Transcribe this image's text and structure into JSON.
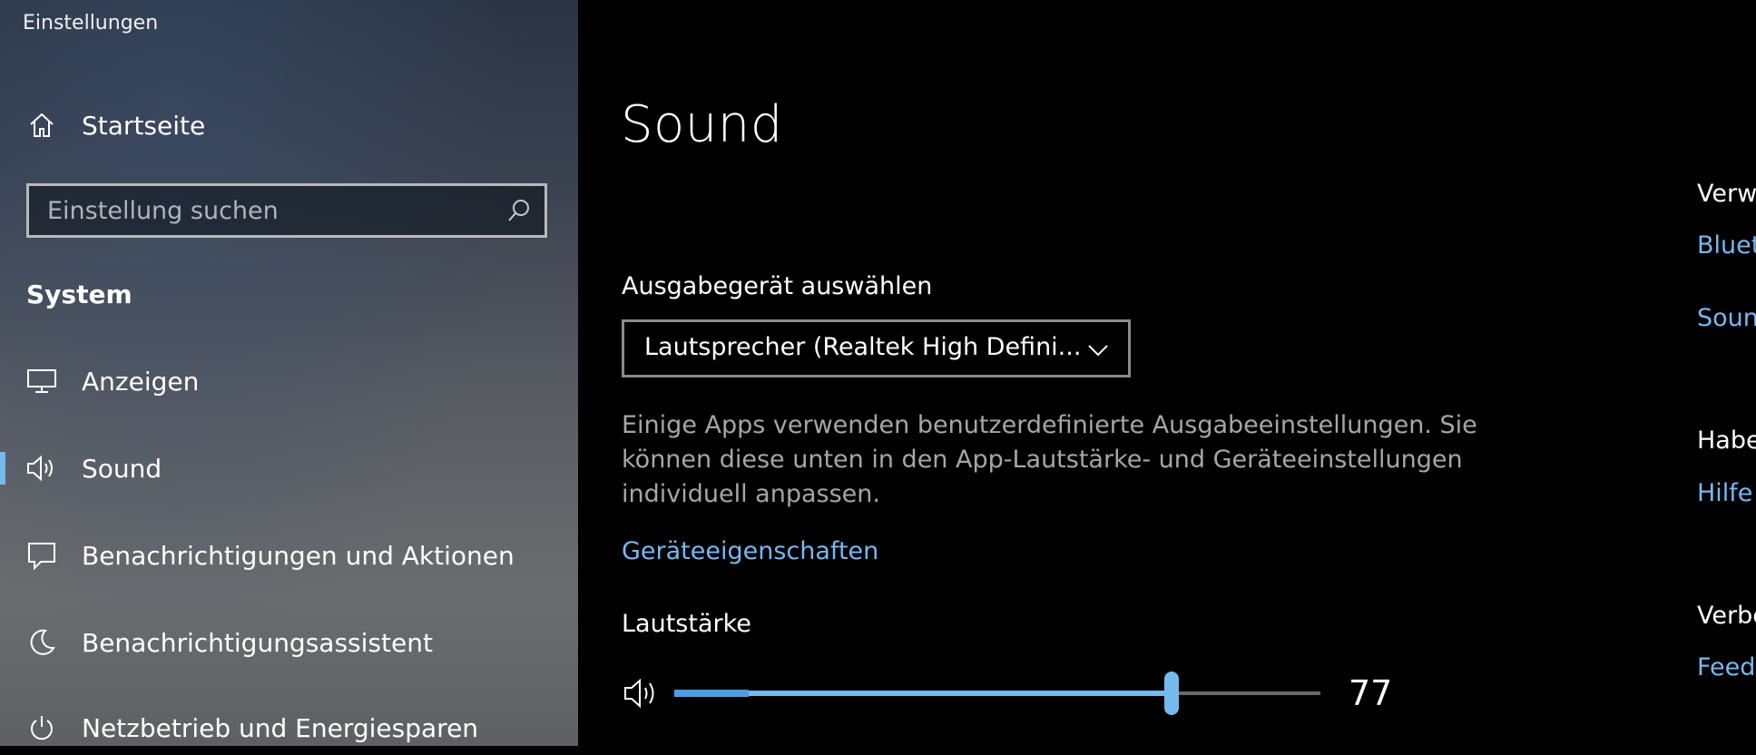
{
  "window": {
    "title": "Einstellungen"
  },
  "sidebar": {
    "home_label": "Startseite",
    "search_placeholder": "Einstellung suchen",
    "group_title": "System",
    "items": [
      {
        "label": "Anzeigen",
        "icon": "monitor-icon"
      },
      {
        "label": "Sound",
        "icon": "speaker-icon",
        "active": true
      },
      {
        "label": "Benachrichtigungen und Aktionen",
        "icon": "notification-icon"
      },
      {
        "label": "Benachrichtigungsassistent",
        "icon": "moon-icon"
      },
      {
        "label": "Netzbetrieb und Energiesparen",
        "icon": "power-icon"
      }
    ]
  },
  "main": {
    "title": "Sound",
    "output_label": "Ausgabegerät auswählen",
    "output_device": "Lautsprecher (Realtek High Defini...",
    "description": "Einige Apps verwenden benutzerdefinierte Ausgabeeinstellungen. Sie können diese unten in den App-Lautstärke- und Geräteeinstellungen individuell anpassen.",
    "device_properties_link": "Geräteeigenschaften",
    "volume_label": "Lautstärke",
    "volume_value": "77",
    "volume_fraction": 0.77
  },
  "right_panel": {
    "heading1": "Verw",
    "link1": "Bluet",
    "link2": "Soun",
    "heading2": "Habe",
    "link3": "Hilfe",
    "heading3": "Verbe",
    "link4": "Feed"
  },
  "colors": {
    "accent": "#76b9ed",
    "link": "#77b8f0",
    "background": "#000000"
  }
}
